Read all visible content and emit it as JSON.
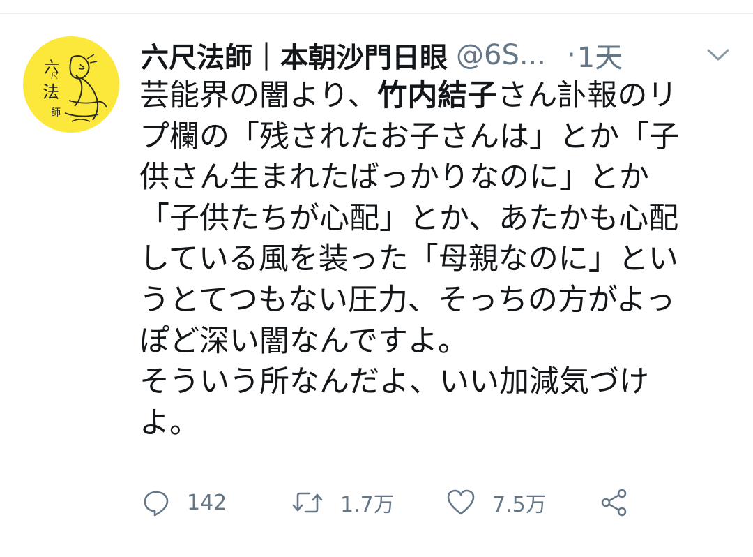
{
  "tweet": {
    "author": {
      "display_name": "六尺法師｜本朝沙門日眼",
      "handle": "@6S...",
      "avatar_label": "六尺法師"
    },
    "separator": "·",
    "time": "1天",
    "text_lines": [
      [
        "芸能界の闇より、",
        "竹内結子",
        "さん訃報のリ"
      ],
      [
        "プ欄の「残されたお子さんは」とか「子"
      ],
      [
        "供さん生まれたばっかりなのに」とか"
      ],
      [
        "「子供たちが心配」とか、あたかも心配"
      ],
      [
        "している風を装った「母親なのに」とい"
      ],
      [
        "うとてつもない圧力、そっちの方がよっ"
      ],
      [
        "ぽど深い闇なんですよ。"
      ],
      [
        "そういう所なんだよ、いい加減気づけ"
      ],
      [
        "よ。"
      ]
    ],
    "actions": {
      "reply_count": "142",
      "retweet_count": "1.7万",
      "like_count": "7.5万"
    },
    "icons": {
      "reply": "reply-icon",
      "retweet": "retweet-icon",
      "like": "heart-icon",
      "share": "share-icon",
      "menu": "chevron-down-icon"
    },
    "colors": {
      "avatar_bg": "#fbe83a",
      "secondary_text": "#657786",
      "primary_text": "#14171a"
    }
  }
}
